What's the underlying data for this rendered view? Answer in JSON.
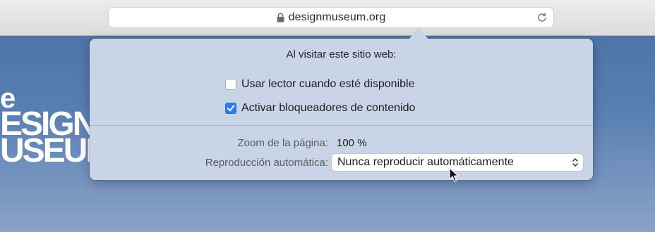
{
  "address_bar": {
    "url": "designmuseum.org"
  },
  "page": {
    "logo_lines": [
      "e",
      "ESIGN",
      "USEUM"
    ]
  },
  "popover": {
    "heading": "Al visitar este sitio web:",
    "reader": {
      "label": "Usar lector cuando esté disponible",
      "checked": false
    },
    "content_blockers": {
      "label": "Activar bloqueadores de contenido",
      "checked": true
    },
    "zoom": {
      "label": "Zoom de la página:",
      "value": "100 %"
    },
    "autoplay": {
      "label": "Reproducción automática:",
      "value": "Nunca reproducir automáticamente"
    }
  },
  "colors": {
    "accent": "#2f7df6",
    "popover_bg": "#c9d5e7",
    "page_bg": "#4e74a8"
  },
  "icons": [
    "lock-icon",
    "reload-icon",
    "checkmark-icon",
    "select-arrows-icon",
    "pointer-cursor"
  ]
}
